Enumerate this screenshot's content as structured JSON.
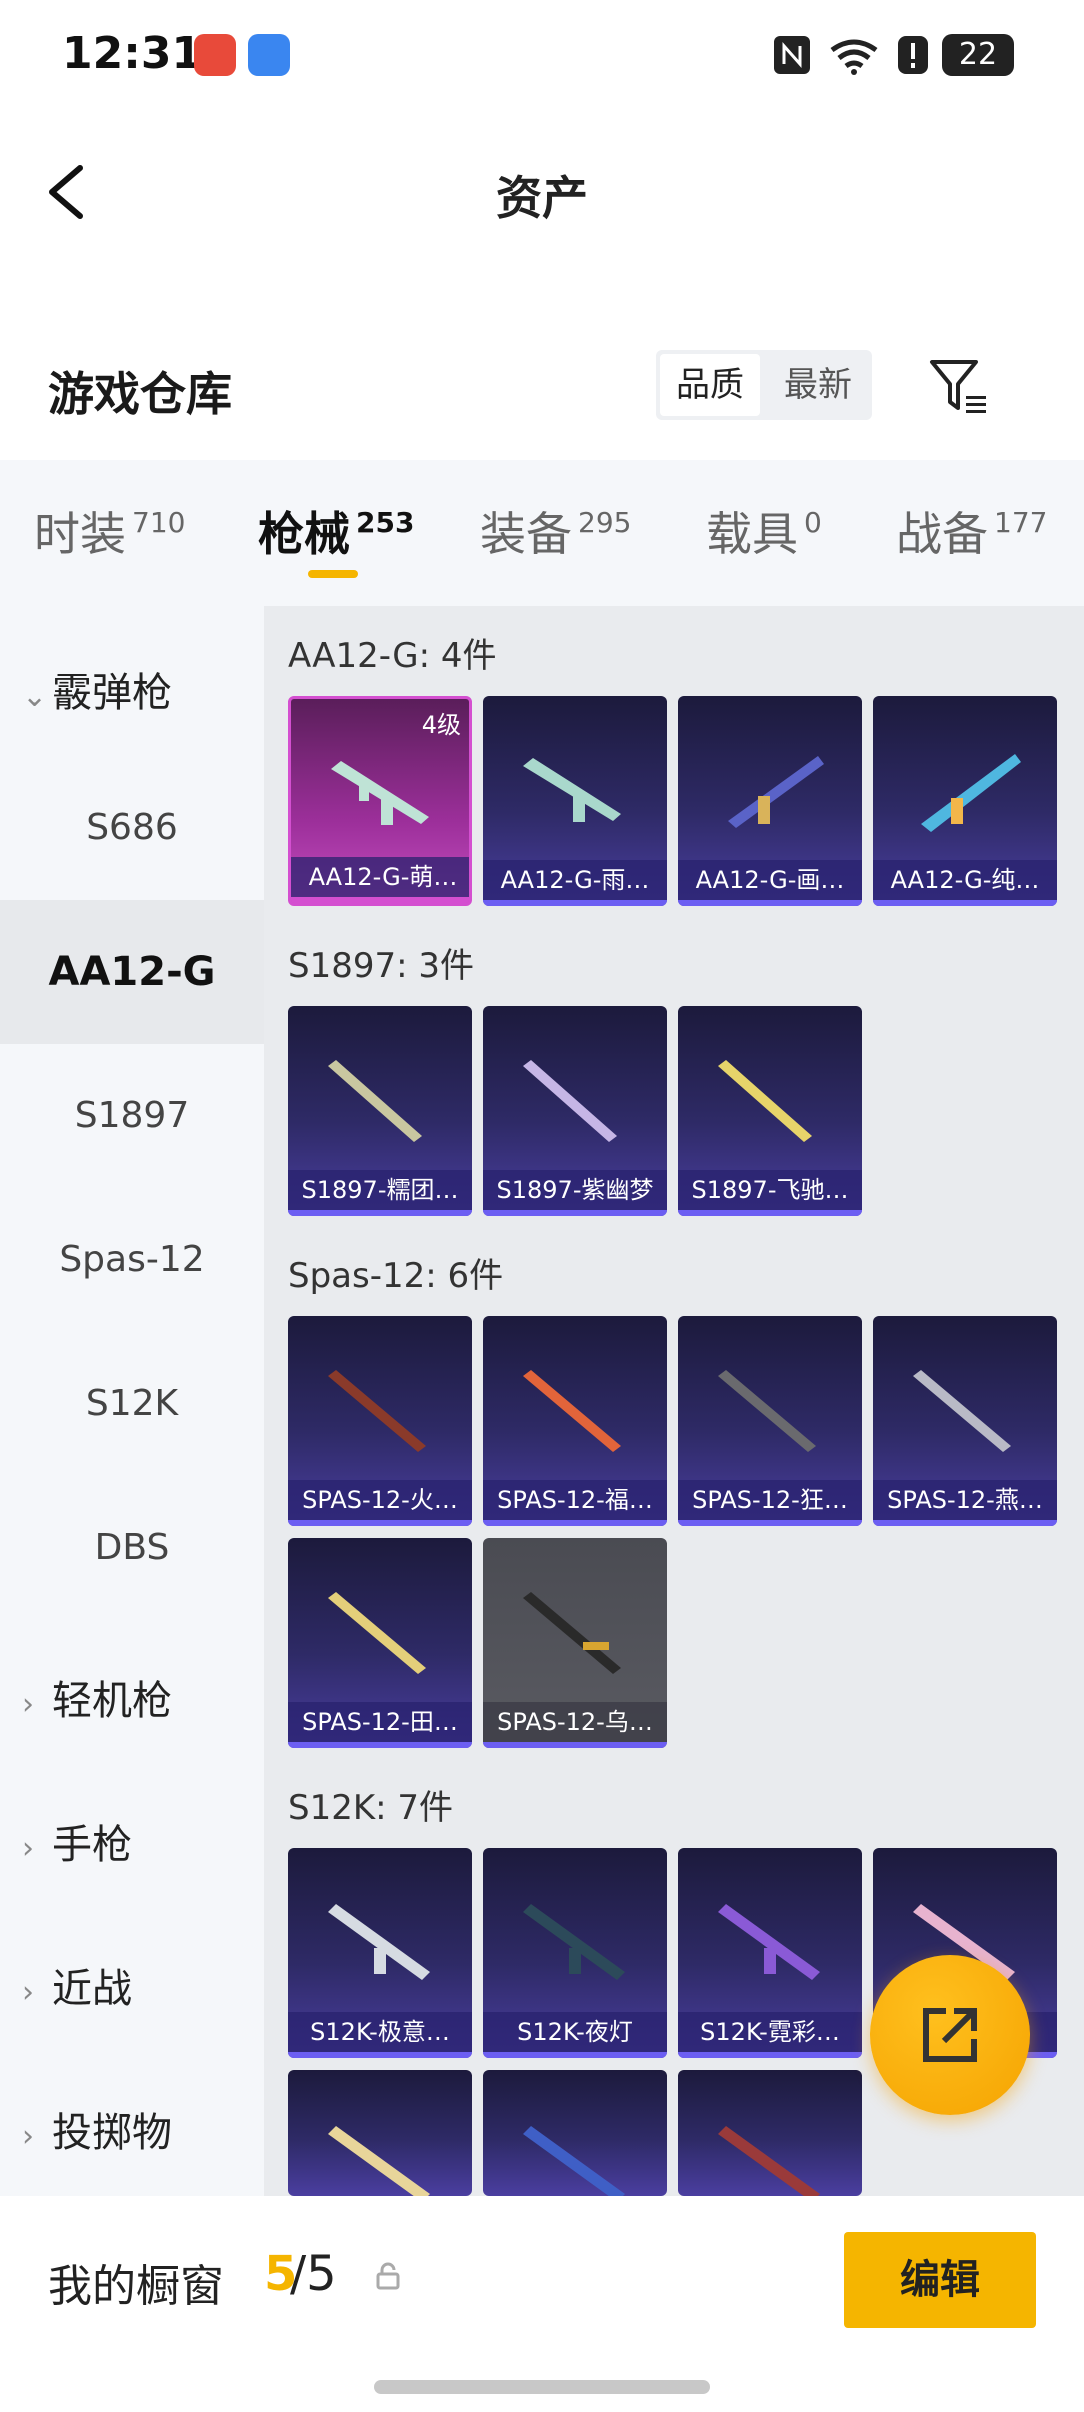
{
  "status_bar": {
    "time": "12:31",
    "battery": "22"
  },
  "nav": {
    "title": "资产"
  },
  "warehouse": {
    "title": "游戏仓库",
    "sort_quality": "品质",
    "sort_latest": "最新"
  },
  "tabs": [
    {
      "label": "时装",
      "count": "710"
    },
    {
      "label": "枪械",
      "count": "253"
    },
    {
      "label": "装备",
      "count": "295"
    },
    {
      "label": "载具",
      "count": "0"
    },
    {
      "label": "战备",
      "count": "177"
    }
  ],
  "sidebar": {
    "group_shotgun": "霰弹枪",
    "items": [
      "S686",
      "AA12-G",
      "S1897",
      "Spas-12",
      "S12K",
      "DBS"
    ],
    "group_lmg": "轻机枪",
    "group_pistol": "手枪",
    "group_melee": "近战",
    "group_throw": "投掷物"
  },
  "sections": [
    {
      "title": "AA12-G: 4件",
      "cards": [
        "AA12-G-萌…",
        "AA12-G-雨…",
        "AA12-G-画…",
        "AA12-G-纯…"
      ],
      "level": "4级"
    },
    {
      "title": "S1897: 3件",
      "cards": [
        "S1897-糯团…",
        "S1897-紫幽梦",
        "S1897-飞驰…"
      ]
    },
    {
      "title": "Spas-12: 6件",
      "cards": [
        "SPAS-12-火…",
        "SPAS-12-福…",
        "SPAS-12-狂…",
        "SPAS-12-燕…",
        "SPAS-12-田…",
        "SPAS-12-乌…"
      ]
    },
    {
      "title": "S12K: 7件",
      "cards": [
        "S12K-极意…",
        "S12K-夜灯",
        "S12K-霓彩…",
        ""
      ]
    }
  ],
  "bottom": {
    "title": "我的橱窗",
    "current": "5",
    "total": "/5",
    "edit": "编辑"
  },
  "colors": {
    "accent": "#f5b500",
    "card_purple": "#2e2a66",
    "card_pink": "#c44dc0"
  }
}
